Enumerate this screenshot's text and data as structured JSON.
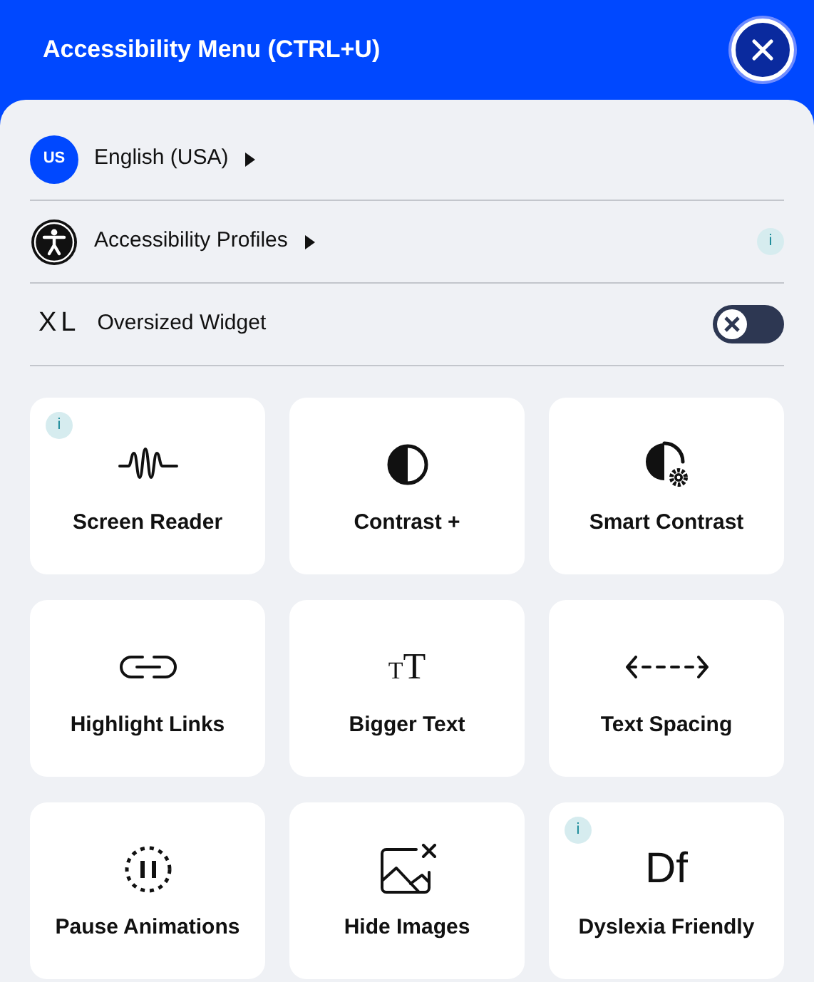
{
  "header": {
    "title": "Accessibility Menu (CTRL+U)"
  },
  "rows": [
    {
      "kind": "language",
      "badge": "US",
      "label": "English (USA)"
    },
    {
      "kind": "profiles",
      "label": "Accessibility Profiles",
      "info": "i"
    },
    {
      "kind": "toggle",
      "badge": "XL",
      "label": "Oversized Widget",
      "on": false
    }
  ],
  "tiles": [
    {
      "kind": "wave",
      "label": "Screen Reader",
      "info": "i"
    },
    {
      "kind": "contrast",
      "label": "Contrast +"
    },
    {
      "kind": "smart",
      "label": "Smart Contrast"
    },
    {
      "kind": "link",
      "label": "Highlight Links"
    },
    {
      "kind": "text",
      "glyph": "TT",
      "label": "Bigger Text"
    },
    {
      "kind": "spacing",
      "label": "Text Spacing"
    },
    {
      "kind": "pause",
      "label": "Pause Animations"
    },
    {
      "kind": "image",
      "label": "Hide Images"
    },
    {
      "kind": "letters",
      "glyph": "Df",
      "label": "Dyslexia Friendly",
      "info": "i"
    }
  ]
}
